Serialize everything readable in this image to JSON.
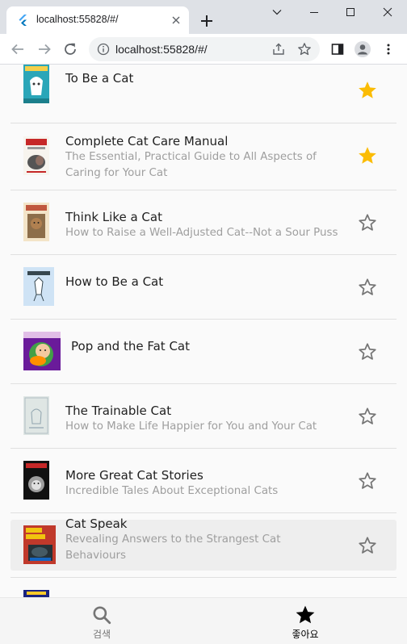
{
  "browser": {
    "tab_title": "localhost:55828/#/",
    "url": "localhost:55828/#/"
  },
  "books": [
    {
      "title": "To Be a Cat",
      "subtitle": "",
      "favorite": true,
      "cover": "cover-to-be-a-cat"
    },
    {
      "title": "Complete Cat Care Manual",
      "subtitle": "The Essential, Practical Guide to All Aspects of Caring for Your Cat",
      "favorite": true,
      "cover": "cover-complete-cat-care"
    },
    {
      "title": "Think Like a Cat",
      "subtitle": "How to Raise a Well-Adjusted Cat--Not a Sour Puss",
      "favorite": false,
      "cover": "cover-think-like-a-cat"
    },
    {
      "title": "How to Be a Cat",
      "subtitle": "",
      "favorite": false,
      "cover": "cover-how-to-be-a-cat"
    },
    {
      "title": "Pop and the Fat Cat",
      "subtitle": "",
      "favorite": false,
      "cover": "cover-pop-fat-cat"
    },
    {
      "title": "The Trainable Cat",
      "subtitle": "How to Make Life Happier for You and Your Cat",
      "favorite": false,
      "cover": "cover-trainable-cat"
    },
    {
      "title": "More Great Cat Stories",
      "subtitle": "Incredible Tales About Exceptional Cats",
      "favorite": false,
      "cover": "cover-more-great-cat-stories"
    },
    {
      "title": "Cat Speak",
      "subtitle": "Revealing Answers to the Strangest Cat Behaviours",
      "favorite": false,
      "cover": "cover-cat-speak",
      "highlighted": true
    }
  ],
  "nav": {
    "search_label": "검색",
    "favorites_label": "좋아요",
    "search_icon": "search-icon",
    "favorites_icon": "star-icon"
  },
  "colors": {
    "favorite_star": "#fbbc05",
    "unfavorite_star": "#757575",
    "title_text": "#212121",
    "subtitle_text": "#9e9e9e"
  }
}
